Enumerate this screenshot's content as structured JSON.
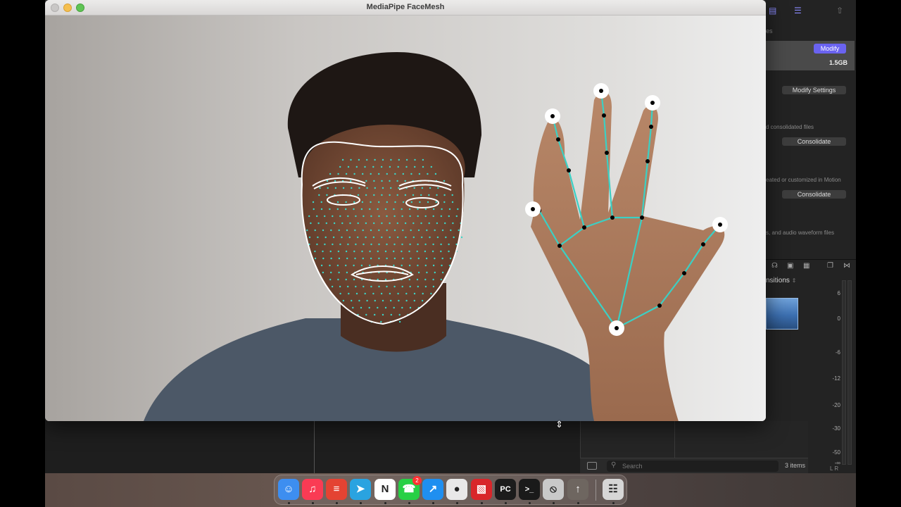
{
  "window": {
    "title": "MediaPipe FaceMesh"
  },
  "motion_panel": {
    "label_top": "es",
    "modify_button": "Modify",
    "size_value": "1.5GB",
    "modify_settings_button": "Modify Settings",
    "consolidated_label": "d consolidated files",
    "consolidate_button_1": "Consolidate",
    "created_label": "eated or customized in Motion",
    "consolidate_button_2": "Consolidate",
    "waveform_label": "s, and audio waveform files",
    "transitions_label": "nsitions",
    "meter_ticks": [
      "6",
      "0",
      "-6",
      "-12",
      "-20",
      "-30",
      "-50",
      "-∞"
    ],
    "meter_lr": "L  R"
  },
  "timeline": {
    "search_placeholder": "Search",
    "item_count": "3 items"
  },
  "dock": {
    "items": [
      {
        "name": "finder",
        "icon": "finder-icon",
        "color": "#3d8ef0",
        "glyph": "☺"
      },
      {
        "name": "music",
        "icon": "music-icon",
        "color": "#fa3b54",
        "glyph": "♫"
      },
      {
        "name": "todoist",
        "icon": "todoist-icon",
        "color": "#e44332",
        "glyph": "≡"
      },
      {
        "name": "telegram",
        "icon": "telegram-icon",
        "color": "#2aa3e0",
        "glyph": "➤"
      },
      {
        "name": "notion",
        "icon": "notion-icon",
        "color": "#ffffff",
        "glyph": "N"
      },
      {
        "name": "whatsapp",
        "icon": "whatsapp-icon",
        "color": "#27d045",
        "glyph": "☎",
        "badge": "2"
      },
      {
        "name": "safari",
        "icon": "safari-icon",
        "color": "#1f8ff0",
        "glyph": "↗"
      },
      {
        "name": "chrome",
        "icon": "chrome-icon",
        "color": "#e8e8e8",
        "glyph": "●"
      },
      {
        "name": "sketchup",
        "icon": "sketchup-icon",
        "color": "#d8262a",
        "glyph": "▧"
      },
      {
        "name": "pycharm",
        "icon": "pycharm-icon",
        "color": "#1c1c1c",
        "glyph": "PC"
      },
      {
        "name": "terminal",
        "icon": "terminal-icon",
        "color": "#1a1a1a",
        "glyph": ">_"
      },
      {
        "name": "disk-utility",
        "icon": "no-entry-icon",
        "color": "#c9c9c9",
        "glyph": "⦸"
      },
      {
        "name": "rocket",
        "icon": "rocket-icon",
        "color": "#6e6660",
        "glyph": "↑"
      },
      {
        "name": "trash",
        "icon": "trash-icon",
        "color": "#d6d6d6",
        "glyph": "☷"
      }
    ]
  },
  "colors": {
    "mesh": "#3ad6c8",
    "contour": "#ffffff",
    "hand_line": "#3bd0c4",
    "accent_button": "#6a63f0"
  }
}
